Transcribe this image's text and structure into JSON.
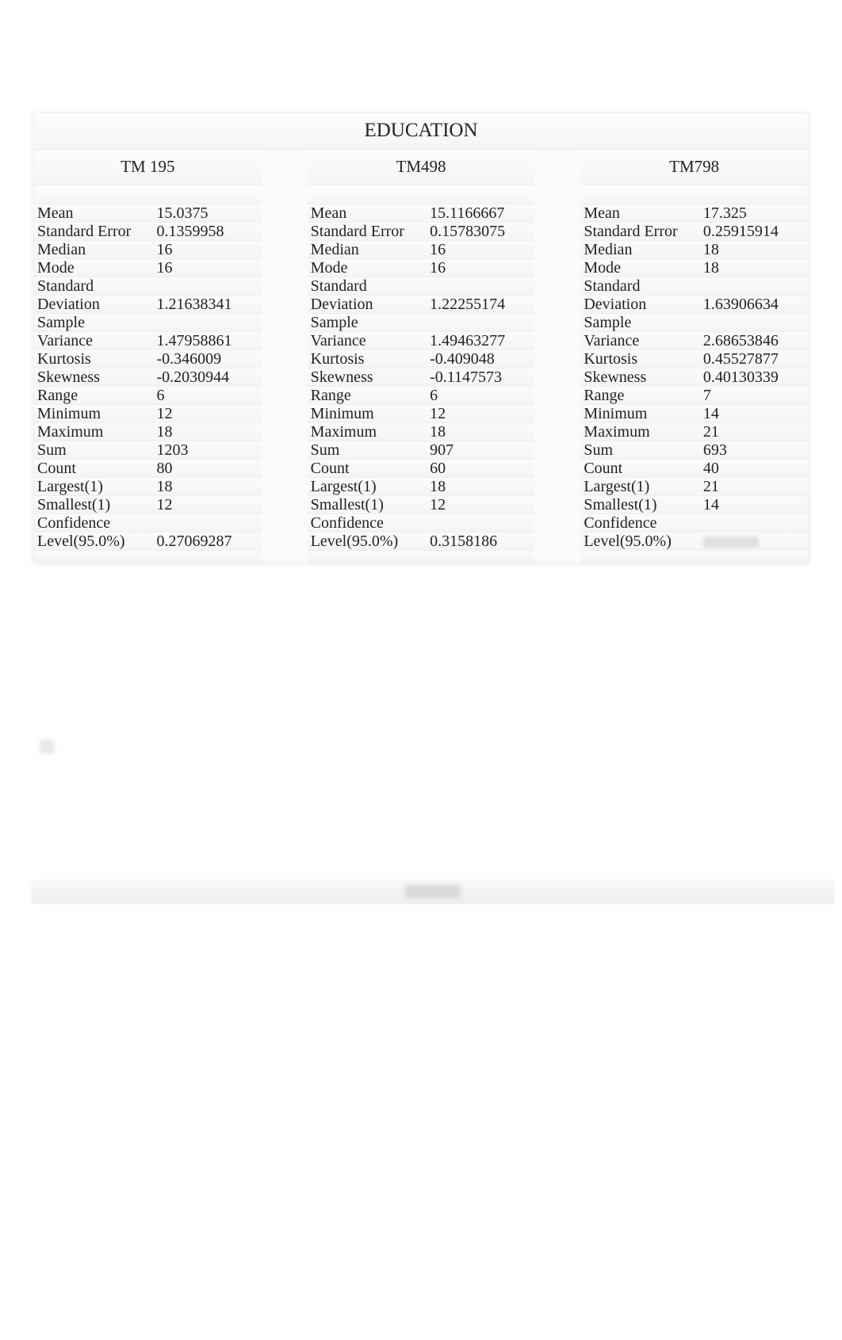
{
  "title": "EDUCATION",
  "columns": [
    {
      "header": "TM 195",
      "rows": [
        {
          "label": "Mean",
          "value": "15.0375"
        },
        {
          "label": "Standard Error",
          "value": "0.1359958"
        },
        {
          "label": "Median",
          "value": "16"
        },
        {
          "label": "Mode",
          "value": "16"
        },
        {
          "label": "Standard Deviation",
          "value": "1.21638341",
          "twoLine": true
        },
        {
          "label": "Sample Variance",
          "value": "1.47958861",
          "twoLine": true
        },
        {
          "label": "Kurtosis",
          "value": "-0.346009"
        },
        {
          "label": "Skewness",
          "value": "-0.2030944"
        },
        {
          "label": "Range",
          "value": "6"
        },
        {
          "label": "Minimum",
          "value": "12"
        },
        {
          "label": "Maximum",
          "value": "18"
        },
        {
          "label": "Sum",
          "value": "1203"
        },
        {
          "label": "Count",
          "value": "80"
        },
        {
          "label": "Largest(1)",
          "value": "18"
        },
        {
          "label": "Smallest(1)",
          "value": "12"
        },
        {
          "label": "Confidence Level(95.0%)",
          "value": "0.27069287",
          "twoLine": true
        }
      ]
    },
    {
      "header": "TM498",
      "rows": [
        {
          "label": "Mean",
          "value": "15.1166667"
        },
        {
          "label": "Standard Error",
          "value": "0.15783075"
        },
        {
          "label": "Median",
          "value": "16"
        },
        {
          "label": "Mode",
          "value": "16"
        },
        {
          "label": "Standard Deviation",
          "value": "1.22255174",
          "twoLine": true
        },
        {
          "label": "Sample Variance",
          "value": "1.49463277",
          "twoLine": true
        },
        {
          "label": "Kurtosis",
          "value": "-0.409048"
        },
        {
          "label": "Skewness",
          "value": "-0.1147573"
        },
        {
          "label": "Range",
          "value": "6"
        },
        {
          "label": "Minimum",
          "value": "12"
        },
        {
          "label": "Maximum",
          "value": "18"
        },
        {
          "label": "Sum",
          "value": "907"
        },
        {
          "label": "Count",
          "value": "60"
        },
        {
          "label": "Largest(1)",
          "value": "18"
        },
        {
          "label": "Smallest(1)",
          "value": "12"
        },
        {
          "label": "Confidence Level(95.0%)",
          "value": "0.3158186",
          "twoLine": true
        }
      ]
    },
    {
      "header": "TM798",
      "rows": [
        {
          "label": "Mean",
          "value": "17.325"
        },
        {
          "label": "Standard Error",
          "value": "0.25915914"
        },
        {
          "label": "Median",
          "value": "18"
        },
        {
          "label": "Mode",
          "value": "18"
        },
        {
          "label": "Standard Deviation",
          "value": "1.63906634",
          "twoLine": true
        },
        {
          "label": "Sample Variance",
          "value": "2.68653846",
          "twoLine": true
        },
        {
          "label": "Kurtosis",
          "value": "0.45527877"
        },
        {
          "label": "Skewness",
          "value": "0.40130339"
        },
        {
          "label": "Range",
          "value": "7"
        },
        {
          "label": "Minimum",
          "value": "14"
        },
        {
          "label": "Maximum",
          "value": "21"
        },
        {
          "label": "Sum",
          "value": "693"
        },
        {
          "label": "Count",
          "value": "40"
        },
        {
          "label": "Largest(1)",
          "value": "21"
        },
        {
          "label": "Smallest(1)",
          "value": "14"
        },
        {
          "label": "Confidence Level(95.0%)",
          "value": "",
          "twoLine": true,
          "obscured": true
        }
      ]
    }
  ],
  "chart_data": {
    "type": "table",
    "title": "EDUCATION",
    "groups": [
      "TM 195",
      "TM498",
      "TM798"
    ],
    "statistics": [
      "Mean",
      "Standard Error",
      "Median",
      "Mode",
      "Standard Deviation",
      "Sample Variance",
      "Kurtosis",
      "Skewness",
      "Range",
      "Minimum",
      "Maximum",
      "Sum",
      "Count",
      "Largest(1)",
      "Smallest(1)",
      "Confidence Level(95.0%)"
    ],
    "series": [
      {
        "name": "TM 195",
        "values": [
          15.0375,
          0.1359958,
          16,
          16,
          1.21638341,
          1.47958861,
          -0.346009,
          -0.2030944,
          6,
          12,
          18,
          1203,
          80,
          18,
          12,
          0.27069287
        ]
      },
      {
        "name": "TM498",
        "values": [
          15.1166667,
          0.15783075,
          16,
          16,
          1.22255174,
          1.49463277,
          -0.409048,
          -0.1147573,
          6,
          12,
          18,
          907,
          60,
          18,
          12,
          0.3158186
        ]
      },
      {
        "name": "TM798",
        "values": [
          17.325,
          0.25915914,
          18,
          18,
          1.63906634,
          2.68653846,
          0.45527877,
          0.40130339,
          7,
          14,
          21,
          693,
          40,
          21,
          14,
          null
        ]
      }
    ]
  }
}
